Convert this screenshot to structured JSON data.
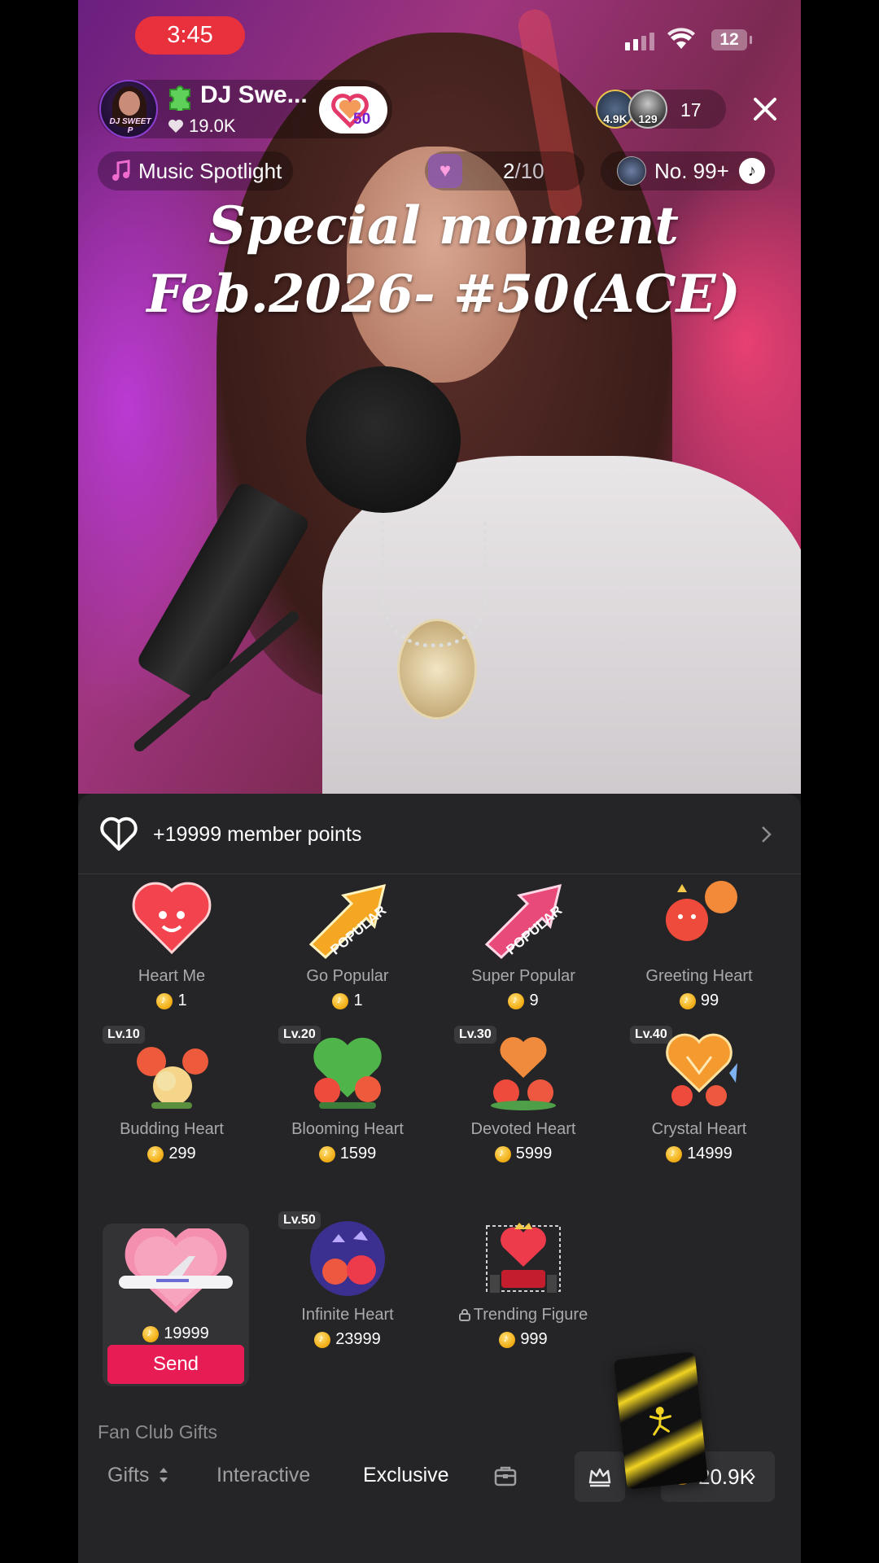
{
  "status_bar": {
    "time": "3:45",
    "battery": "12"
  },
  "host": {
    "name": "DJ Swe...",
    "likes": "19.0K",
    "fan_level": "50",
    "avatar_tag": "DJ SWEET P"
  },
  "viewers": {
    "avatar1_label": "4.9K",
    "avatar2_label": "129",
    "count": "17"
  },
  "chips": {
    "music_label": "Music Spotlight",
    "rank_current": "2",
    "rank_total": "/10",
    "no_label": "No. 99+"
  },
  "overlay_text": {
    "line1": "Special moment",
    "line2": "Feb.2026- #50(ACE)"
  },
  "member_bar": {
    "text": "+19999 member points"
  },
  "gifts": [
    {
      "name": "Heart Me",
      "price": "1"
    },
    {
      "name": "Go Popular",
      "price": "1"
    },
    {
      "name": "Super Popular",
      "price": "9"
    },
    {
      "name": "Greeting Heart",
      "price": "99"
    },
    {
      "name": "Budding Heart",
      "price": "299",
      "level": "Lv.10"
    },
    {
      "name": "Blooming Heart",
      "price": "1599",
      "level": "Lv.20"
    },
    {
      "name": "Devoted Heart",
      "price": "5999",
      "level": "Lv.30"
    },
    {
      "name": "Crystal Heart",
      "price": "14999",
      "level": "Lv.40"
    },
    {
      "name": "",
      "price": "19999"
    },
    {
      "name": "Infinite Heart",
      "price": "23999",
      "level": "Lv.50"
    },
    {
      "name": "Trending Figure",
      "price": "999"
    }
  ],
  "popular_word": "POPULAR",
  "send_label": "Send",
  "section_label": "Fan Club Gifts",
  "tabs": {
    "gifts": "Gifts",
    "interactive": "Interactive",
    "exclusive": "Exclusive"
  },
  "balance": "20.9K",
  "colors": {
    "accent": "#e81c55",
    "status_pill": "#e8313c",
    "panel_bg": "#252527"
  }
}
